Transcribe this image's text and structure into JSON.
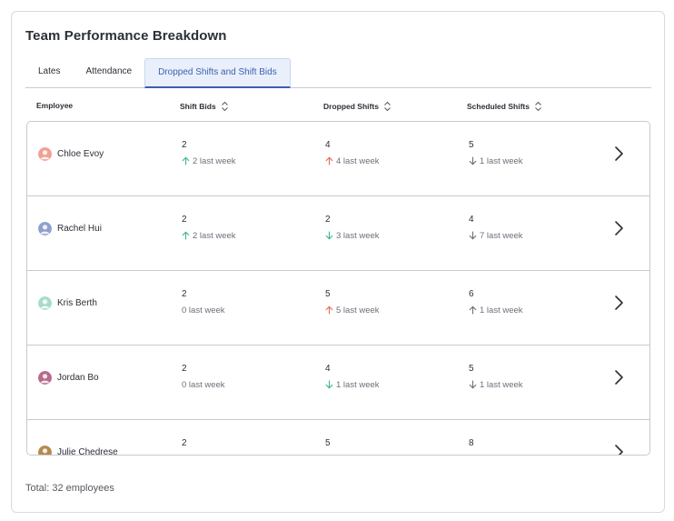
{
  "title": "Team Performance Breakdown",
  "tabs": [
    {
      "label": "Lates",
      "active": false
    },
    {
      "label": "Attendance",
      "active": false
    },
    {
      "label": "Dropped Shifts and Shift Bids",
      "active": true
    }
  ],
  "columns": {
    "employee": "Employee",
    "shift_bids": "Shift Bids",
    "dropped_shifts": "Dropped Shifts",
    "scheduled_shifts": "Scheduled Shifts"
  },
  "colors": {
    "up_green": "#3fb39a",
    "up_red": "#e46a55",
    "down": "#6b7079",
    "neutral": "#6b7079",
    "accent": "#3d5fb3"
  },
  "rows": [
    {
      "name": "Chloe Evoy",
      "avatar_color": "#f0a092",
      "avatar_icon": "person-avatar-icon",
      "shift_bids": {
        "value": "2",
        "delta": "2 last week",
        "trend": "up_green"
      },
      "dropped_shifts": {
        "value": "4",
        "delta": "4 last week",
        "trend": "up_red"
      },
      "scheduled_shifts": {
        "value": "5",
        "delta": "1 last week",
        "trend": "down"
      }
    },
    {
      "name": "Rachel Hui",
      "avatar_color": "#8f9fcf",
      "avatar_icon": "person-avatar-icon",
      "shift_bids": {
        "value": "2",
        "delta": "2 last week",
        "trend": "up_green"
      },
      "dropped_shifts": {
        "value": "2",
        "delta": "3 last week",
        "trend": "down_green"
      },
      "scheduled_shifts": {
        "value": "4",
        "delta": "7 last week",
        "trend": "down"
      }
    },
    {
      "name": "Kris Berth",
      "avatar_color": "#a7dccd",
      "avatar_icon": "person-avatar-icon",
      "shift_bids": {
        "value": "2",
        "delta": "0 last week",
        "trend": "none"
      },
      "dropped_shifts": {
        "value": "5",
        "delta": "5 last week",
        "trend": "up_red"
      },
      "scheduled_shifts": {
        "value": "6",
        "delta": "1 last week",
        "trend": "up"
      }
    },
    {
      "name": "Jordan Bo",
      "avatar_color": "#b86a8e",
      "avatar_icon": "person-avatar-icon",
      "shift_bids": {
        "value": "2",
        "delta": "0 last week",
        "trend": "none"
      },
      "dropped_shifts": {
        "value": "4",
        "delta": "1 last week",
        "trend": "down_green"
      },
      "scheduled_shifts": {
        "value": "5",
        "delta": "1 last week",
        "trend": "down"
      }
    },
    {
      "name": "Julie Chedrese",
      "avatar_color": "#b58a4e",
      "avatar_icon": "person-avatar-icon",
      "shift_bids": {
        "value": "2",
        "delta": "",
        "trend": "none"
      },
      "dropped_shifts": {
        "value": "5",
        "delta": "",
        "trend": "none"
      },
      "scheduled_shifts": {
        "value": "8",
        "delta": "",
        "trend": "none"
      }
    }
  ],
  "total": "Total: 32 employees"
}
